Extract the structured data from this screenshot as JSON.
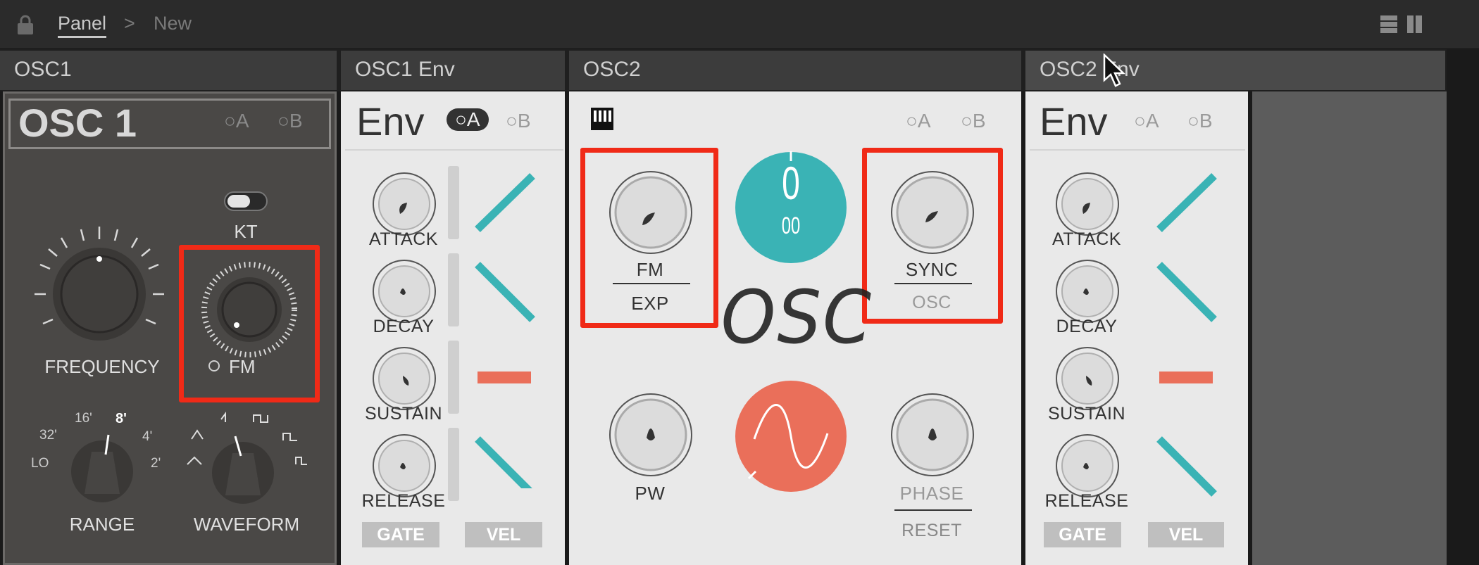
{
  "breadcrumb": {
    "panel": "Panel",
    "sep": ">",
    "current": "New"
  },
  "headers": {
    "osc1": "OSC1",
    "osc1_env": "OSC1 Env",
    "osc2": "OSC2",
    "osc2_env": "OSC2 Env"
  },
  "osc1": {
    "title": "OSC 1",
    "opt_a": "A",
    "opt_b": "B",
    "kt": "KT",
    "frequency": "FREQUENCY",
    "fm": "FM",
    "range": "RANGE",
    "waveform": "WAVEFORM",
    "range_ticks": [
      "LO",
      "32'",
      "16'",
      "8'",
      "4'",
      "2'"
    ]
  },
  "env1": {
    "title": "Env",
    "opt_a": "A",
    "opt_b": "B",
    "labels": [
      "ATTACK",
      "DECAY",
      "SUSTAIN",
      "RELEASE"
    ],
    "gate": "GATE",
    "vel": "VEL"
  },
  "osc2": {
    "opt_a": "A",
    "opt_b": "B",
    "fm": "FM",
    "exp": "EXP",
    "sync": "SYNC",
    "osc_sub": "OSC",
    "logo": "OSC",
    "pw": "PW",
    "phase": "PHASE",
    "reset": "RESET",
    "octave_main": "0",
    "octave_sub": "00"
  },
  "env2": {
    "title": "Env",
    "opt_a": "A",
    "opt_b": "B",
    "labels": [
      "ATTACK",
      "DECAY",
      "SUSTAIN",
      "RELEASE"
    ],
    "gate": "GATE",
    "vel": "VEL"
  },
  "colors": {
    "teal": "#3ab3b5",
    "coral": "#ea6f5a",
    "highlight": "#f02a17"
  }
}
